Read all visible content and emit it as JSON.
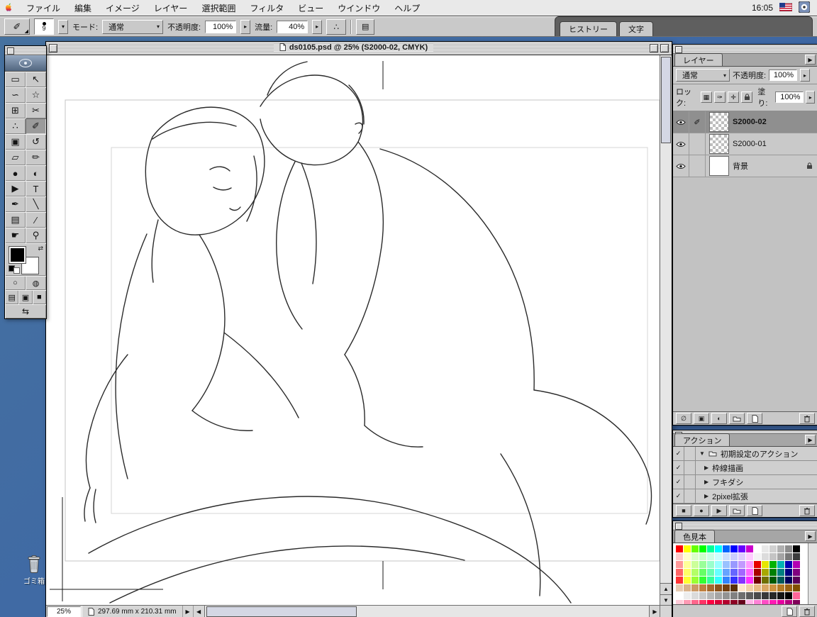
{
  "menubar": {
    "items": [
      "ファイル",
      "編集",
      "イメージ",
      "レイヤー",
      "選択範囲",
      "フィルタ",
      "ビュー",
      "ウインドウ",
      "ヘルプ"
    ],
    "clock": "16:05"
  },
  "options_bar": {
    "brush_size": "9",
    "mode_label": "モード:",
    "mode_value": "通常",
    "opacity_label": "不透明度:",
    "opacity_value": "100%",
    "flow_label": "流量:",
    "flow_value": "40%",
    "well_tabs": [
      "ヒストリー",
      "文字"
    ]
  },
  "toolbox": {
    "tools": [
      {
        "name": "rect-marquee",
        "glyph": "▭"
      },
      {
        "name": "move",
        "glyph": "↖"
      },
      {
        "name": "lasso",
        "glyph": "∽"
      },
      {
        "name": "magic-wand",
        "glyph": "☆"
      },
      {
        "name": "crop",
        "glyph": "⊞"
      },
      {
        "name": "slice",
        "glyph": "✂"
      },
      {
        "name": "airbrush",
        "glyph": "∴"
      },
      {
        "name": "paintbrush",
        "glyph": "✐",
        "active": true
      },
      {
        "name": "clone-stamp",
        "glyph": "▣"
      },
      {
        "name": "history-brush",
        "glyph": "↺"
      },
      {
        "name": "eraser",
        "glyph": "▱"
      },
      {
        "name": "pencil",
        "glyph": "✏"
      },
      {
        "name": "blur",
        "glyph": "●"
      },
      {
        "name": "dodge",
        "glyph": "◐"
      },
      {
        "name": "path-select",
        "glyph": "▶"
      },
      {
        "name": "type",
        "glyph": "T"
      },
      {
        "name": "pen",
        "glyph": "✒"
      },
      {
        "name": "line",
        "glyph": "╲"
      },
      {
        "name": "notes",
        "glyph": "▤"
      },
      {
        "name": "eyedropper",
        "glyph": "∕"
      },
      {
        "name": "hand",
        "glyph": "☛"
      },
      {
        "name": "zoom",
        "glyph": "⚲"
      }
    ]
  },
  "desktop": {
    "trash_label": "ゴミ箱"
  },
  "document_window": {
    "title": "ds0105.psd @ 25% (S2000-02, CMYK)",
    "zoom": "25%",
    "size_readout": "297.69 mm x 210.31 mm"
  },
  "layers_panel": {
    "tab": "レイヤー",
    "blend_mode": "通常",
    "opacity_label": "不透明度:",
    "opacity_value": "100%",
    "lock_label": "ロック:",
    "fill_label": "塗り:",
    "fill_value": "100%",
    "layers": [
      {
        "name": "S2000-02",
        "selected": true
      },
      {
        "name": "S2000-01",
        "selected": false
      },
      {
        "name": "背景",
        "selected": false,
        "locked": true
      }
    ]
  },
  "actions_panel": {
    "tab": "アクション",
    "set_name": "初期設定のアクション",
    "actions": [
      "枠線描画",
      "フキダシ",
      "2pixel拡張"
    ]
  },
  "swatches_panel": {
    "tab": "色見本",
    "rows": [
      [
        "#FF0000",
        "#FFFF00",
        "#66FF00",
        "#00FF00",
        "#00FF99",
        "#00FFFF",
        "#0066FF",
        "#0000FF",
        "#6600FF",
        "#CC00CC",
        "#FFFFFF",
        "#E8E8E8",
        "#D0D0D0",
        "#B0B0B0",
        "#8C8C8C",
        "#000000"
      ],
      [
        "#FFCCCC",
        "#FFFFCC",
        "#DDFFCC",
        "#CCFFCC",
        "#CCFFE6",
        "#CCFFFF",
        "#CCE0FF",
        "#CCCCFF",
        "#E0CCFF",
        "#FFCCFF",
        "#F4F4F4",
        "#DCDCDC",
        "#C4C4C4",
        "#A4A4A4",
        "#787878",
        "#3C3C3C"
      ],
      [
        "#FF9999",
        "#FFFF99",
        "#CCFF99",
        "#99FF99",
        "#99FFCC",
        "#99FFFF",
        "#99C2FF",
        "#9999FF",
        "#C299FF",
        "#FF99FF",
        "#E60000",
        "#E6E600",
        "#00B300",
        "#00B3B3",
        "#0000B3",
        "#B300B3"
      ],
      [
        "#FF6666",
        "#FFFF66",
        "#B3FF66",
        "#66FF66",
        "#66FFB3",
        "#66FFFF",
        "#66A3FF",
        "#6666FF",
        "#A366FF",
        "#FF66FF",
        "#A80000",
        "#A8A800",
        "#008000",
        "#008080",
        "#000080",
        "#800080"
      ],
      [
        "#FF3333",
        "#FFFF33",
        "#99FF33",
        "#33FF33",
        "#33FF99",
        "#33FFFF",
        "#3385FF",
        "#3333FF",
        "#8533FF",
        "#FF33FF",
        "#700000",
        "#707000",
        "#005900",
        "#005959",
        "#000059",
        "#590059"
      ],
      [
        "#E6CCB3",
        "#D9B38C",
        "#CC9966",
        "#BF8040",
        "#A66A2E",
        "#8C531D",
        "#734012",
        "#59300A",
        "#FFE6CC",
        "#F2D1A9",
        "#E6BC86",
        "#D9A763",
        "#CC9240",
        "#B37A26",
        "#996214",
        "#804F00"
      ],
      [
        "#FFFFFF",
        "#EDEDED",
        "#DBDBDB",
        "#C9C9C9",
        "#B7B7B7",
        "#A5A5A5",
        "#939393",
        "#818181",
        "#6F6F6F",
        "#5D5D5D",
        "#4B4B4B",
        "#393939",
        "#272727",
        "#151515",
        "#000000",
        "#FF6699"
      ],
      [
        "#FFCCD9",
        "#FF99B3",
        "#FF668C",
        "#FF3366",
        "#FF0040",
        "#D90036",
        "#B3002D",
        "#8C0023",
        "#66001A",
        "#FFB3E6",
        "#FF80D5",
        "#FF4DC4",
        "#FF1AB3",
        "#E600A0",
        "#B3007D",
        "#800059"
      ]
    ]
  },
  "colors": {
    "desktop_blue": "#3E68A5"
  }
}
